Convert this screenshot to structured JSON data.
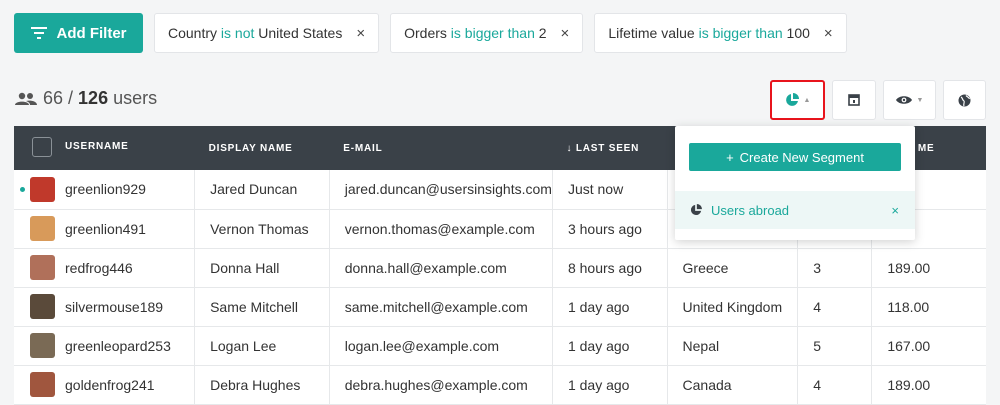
{
  "filters": {
    "add_label": "Add Filter",
    "chips": [
      {
        "field": "Country",
        "op": "is not",
        "value": "United States"
      },
      {
        "field": "Orders",
        "op": "is bigger than",
        "value": "2"
      },
      {
        "field": "Lifetime value",
        "op": "is bigger than",
        "value": "100"
      }
    ],
    "remove_glyph": "×"
  },
  "count": {
    "shown": "66",
    "sep": " / ",
    "total": "126",
    "unit": "users"
  },
  "toolbar": {
    "segments_icon": "pie-chart-icon",
    "columns_icon": "columns-icon",
    "view_icon": "eye-icon",
    "globe_icon": "globe-icon",
    "caret": "▲",
    "caret_down": "▼"
  },
  "table": {
    "headers": [
      "USERNAME",
      "DISPLAY NAME",
      "E-MAIL",
      "↓ LAST SEEN",
      "",
      "",
      "ME"
    ],
    "rows": [
      {
        "username": "greenlion929",
        "display": "Jared Duncan",
        "email": "jared.duncan@usersinsights.com",
        "last_seen": "Just now",
        "country": "",
        "orders": "",
        "ltv": "00",
        "online": true,
        "avatar_color": "#c0392b"
      },
      {
        "username": "greenlion491",
        "display": "Vernon Thomas",
        "email": "vernon.thomas@example.com",
        "last_seen": "3 hours ago",
        "country": "",
        "orders": "",
        "ltv": "00",
        "online": false,
        "avatar_color": "#d89a5a"
      },
      {
        "username": "redfrog446",
        "display": "Donna Hall",
        "email": "donna.hall@example.com",
        "last_seen": "8 hours ago",
        "country": "Greece",
        "orders": "3",
        "ltv": "189.00",
        "online": false,
        "avatar_color": "#b0705a"
      },
      {
        "username": "silvermouse189",
        "display": "Same Mitchell",
        "email": "same.mitchell@example.com",
        "last_seen": "1 day ago",
        "country": "United Kingdom",
        "orders": "4",
        "ltv": "118.00",
        "online": false,
        "avatar_color": "#5a4a3a"
      },
      {
        "username": "greenleopard253",
        "display": "Logan Lee",
        "email": "logan.lee@example.com",
        "last_seen": "1 day ago",
        "country": "Nepal",
        "orders": "5",
        "ltv": "167.00",
        "online": false,
        "avatar_color": "#7a6a55"
      },
      {
        "username": "goldenfrog241",
        "display": "Debra Hughes",
        "email": "debra.hughes@example.com",
        "last_seen": "1 day ago",
        "country": "Canada",
        "orders": "4",
        "ltv": "189.00",
        "online": false,
        "avatar_color": "#a0563e"
      }
    ]
  },
  "segments_dropdown": {
    "create_label": "Create New Segment",
    "create_prefix": "+",
    "items": [
      {
        "label": "Users abroad",
        "remove": "×"
      }
    ]
  },
  "colors": {
    "accent": "#1aa89b",
    "header_bg": "#3a4148",
    "highlight": "#e8141c"
  }
}
